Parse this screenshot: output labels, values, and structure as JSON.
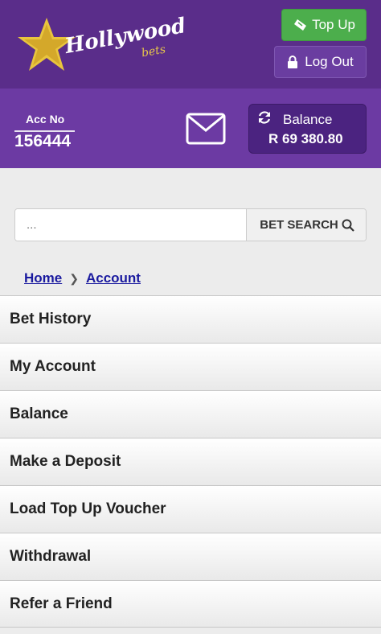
{
  "header": {
    "logo_main": "Hollywood",
    "logo_sub": "bets",
    "topup_label": "Top Up",
    "logout_label": "Log Out"
  },
  "account": {
    "acc_label": "Acc No",
    "acc_number": "156444",
    "balance_label": "Balance",
    "balance_value": "R 69 380.80"
  },
  "search": {
    "placeholder": "...",
    "button_label": "BET SEARCH"
  },
  "breadcrumb": {
    "home": "Home",
    "current": "Account"
  },
  "menu": {
    "items": [
      {
        "label": "Bet History"
      },
      {
        "label": "My Account"
      },
      {
        "label": "Balance"
      },
      {
        "label": "Make a Deposit"
      },
      {
        "label": "Load Top Up Voucher"
      },
      {
        "label": "Withdrawal"
      },
      {
        "label": "Refer a Friend"
      }
    ]
  },
  "icons": {
    "topup": "ticket-icon",
    "logout": "lock-icon",
    "mail": "envelope-icon",
    "balance": "refresh-icon",
    "search": "search-icon",
    "breadcrumb_separator": "chevron-right-icon"
  },
  "colors": {
    "header_dark": "#5a2d8a",
    "header_purple": "#6c3aa3",
    "topup_green": "#4cae4c",
    "balance_box": "#4b2380",
    "link_blue": "#1a1a9f"
  }
}
